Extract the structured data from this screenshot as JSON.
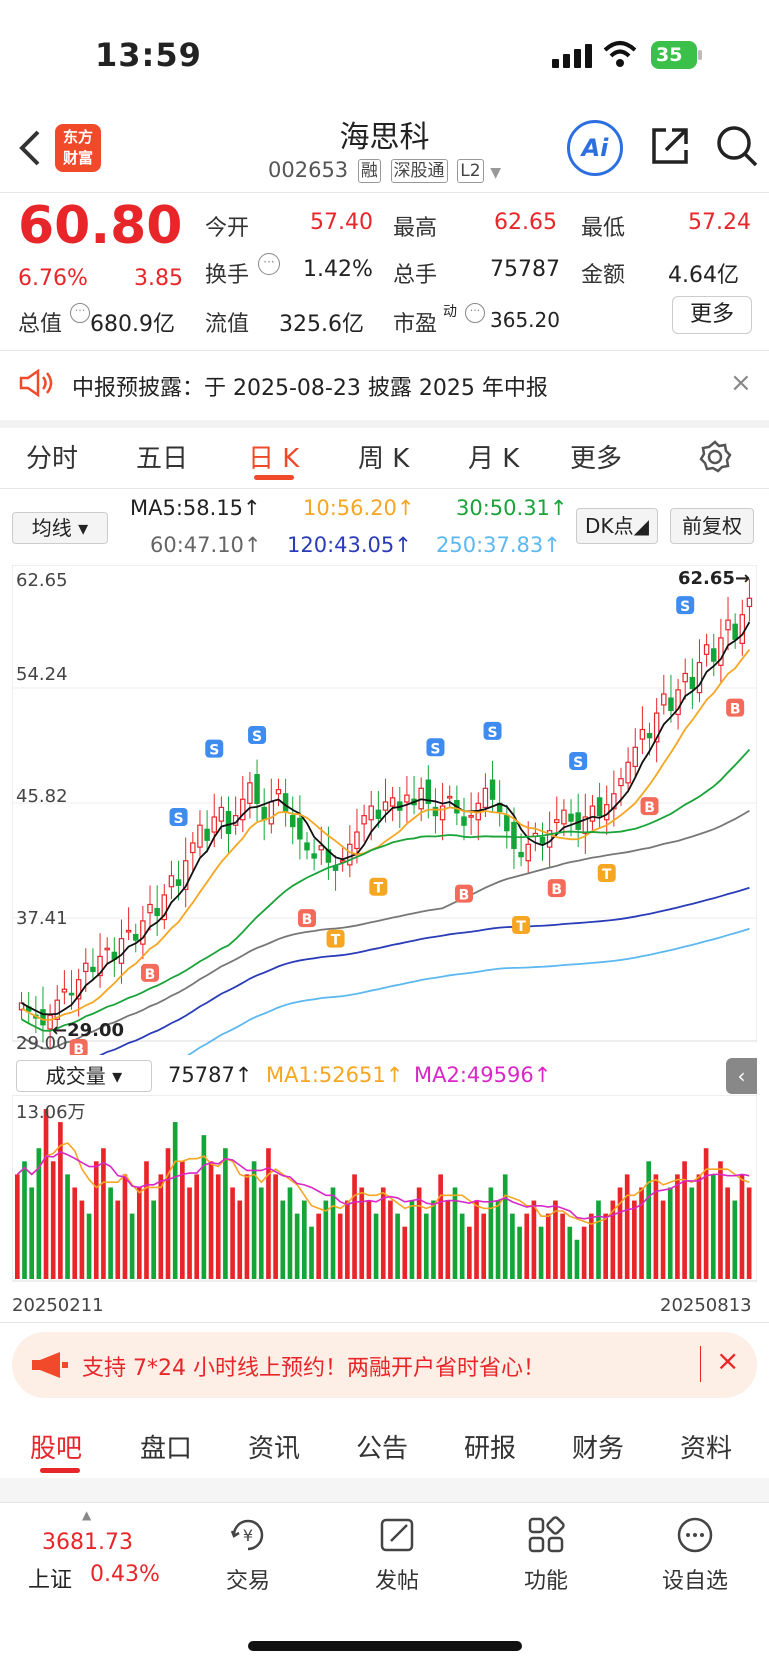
{
  "status": {
    "time": "13:59",
    "battery": "35"
  },
  "header": {
    "title": "海思科",
    "code": "002653",
    "tags": [
      "融",
      "深股通",
      "L2"
    ],
    "logo": "东方\n财富"
  },
  "quote": {
    "price": "60.80",
    "change_pct": "6.76%",
    "change": "3.85",
    "open_label": "今开",
    "open": "57.40",
    "high_label": "最高",
    "high": "62.65",
    "low_label": "最低",
    "low": "57.24",
    "turnover_label": "换手",
    "turnover": "1.42%",
    "volume_label": "总手",
    "volume": "75787",
    "amount_label": "金额",
    "amount": "4.64亿",
    "mktcap_label": "总值",
    "mktcap": "680.9亿",
    "float_label": "流值",
    "float": "325.6亿",
    "pe_label": "市盈",
    "pe_sup": "动",
    "pe": "365.20",
    "more_label": "更多"
  },
  "notice": {
    "text": "中报预披露：于 2025-08-23 披露 2025 年中报"
  },
  "period_tabs": [
    "分时",
    "五日",
    "日 K",
    "周 K",
    "月 K",
    "更多"
  ],
  "active_period": 2,
  "ma_bar": {
    "selector": "均线",
    "ma5": "MA5:58.15↑",
    "ma10": "10:56.20↑",
    "ma30": "30:50.31↑",
    "ma60": "60:47.10↑",
    "ma120": "120:43.05↑",
    "ma250": "250:37.83↑",
    "dk_label": "DK点",
    "adjust_label": "前复权"
  },
  "colors": {
    "up": "#e8262a",
    "down": "#13a538",
    "ma5": "#111111",
    "ma10": "#f5a623",
    "ma30": "#19a338",
    "ma60": "#777777",
    "ma120": "#2a3cb8",
    "ma250": "#5cb8f0",
    "accent": "#f04a2b"
  },
  "chart_data": {
    "type": "candlestick",
    "y_ticks": [
      "62.65",
      "54.24",
      "45.82",
      "37.41",
      "29.00"
    ],
    "ylim": [
      29.0,
      62.65
    ],
    "high_marker": "62.65",
    "low_marker": "29.00",
    "x_start": "20250211",
    "x_end": "20250813",
    "closes": [
      31.2,
      30.6,
      30.1,
      29.6,
      30.3,
      31.4,
      32.2,
      31.8,
      32.9,
      34.1,
      33.5,
      34.6,
      35.2,
      34.4,
      35.9,
      36.5,
      35.8,
      37.2,
      38.4,
      37.6,
      39.1,
      40.5,
      39.8,
      41.6,
      42.9,
      44.2,
      43.1,
      44.8,
      45.5,
      43.6,
      44.9,
      46.1,
      47.3,
      45.8,
      44.6,
      45.9,
      46.8,
      45.2,
      44.1,
      43.2,
      42.4,
      41.8,
      42.7,
      41.5,
      40.9,
      41.6,
      42.8,
      43.7,
      44.9,
      45.6,
      44.7,
      45.9,
      46.2,
      45.3,
      46.4,
      45.7,
      46.9,
      45.8,
      44.9,
      45.6,
      46.3,
      45.1,
      44.2,
      44.9,
      45.8,
      46.9,
      46.1,
      45.2,
      43.8,
      42.5,
      41.9,
      42.8,
      43.6,
      42.9,
      43.8,
      44.6,
      45.3,
      44.5,
      43.9,
      44.8,
      45.6,
      44.9,
      45.7,
      46.5,
      47.6,
      48.8,
      49.9,
      51.2,
      50.6,
      52.4,
      53.8,
      52.6,
      54.1,
      55.3,
      54.2,
      56.1,
      57.4,
      56.2,
      57.9,
      59.2,
      57.8,
      59.6,
      60.8
    ],
    "bs_markers": [
      "B",
      "S",
      "T"
    ],
    "volume": {
      "selector": "成交量",
      "value": "75787↑",
      "ma1": "MA1:52651↑",
      "ma2": "MA2:49596↑",
      "max_label": "13.06万",
      "values": [
        8,
        9,
        7,
        10,
        13,
        9,
        12,
        8,
        7,
        6,
        5,
        9,
        10,
        7,
        6,
        8,
        5,
        7,
        9,
        6,
        8,
        10,
        12,
        9,
        7,
        8,
        11,
        9,
        8,
        10,
        7,
        6,
        8,
        9,
        7,
        10,
        8,
        6,
        7,
        5,
        6,
        4,
        5,
        6,
        7,
        5,
        6,
        8,
        7,
        6,
        5,
        7,
        6,
        5,
        4,
        6,
        7,
        5,
        6,
        8,
        6,
        7,
        5,
        4,
        6,
        5,
        7,
        6,
        8,
        5,
        4,
        5,
        6,
        4,
        5,
        6,
        5,
        4,
        3,
        4,
        5,
        6,
        5,
        6,
        7,
        8,
        6,
        7,
        9,
        8,
        6,
        7,
        8,
        9,
        7,
        8,
        10,
        8,
        9,
        7,
        6,
        8,
        7
      ]
    }
  },
  "banner": {
    "text": "支持 7*24 小时线上预约！两融开户省时省心！"
  },
  "bottom_tabs": [
    "股吧",
    "盘口",
    "资讯",
    "公告",
    "研报",
    "财务",
    "资料"
  ],
  "nav": {
    "index_value": "3681.73",
    "index_name": "上证",
    "index_change": "0.43%",
    "items": [
      "交易",
      "发帖",
      "功能",
      "设自选"
    ]
  }
}
